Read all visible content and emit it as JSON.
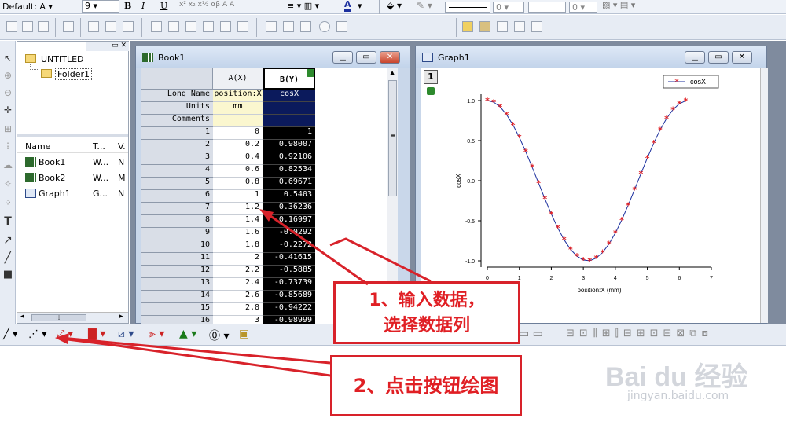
{
  "toolbar": {
    "font_label": "Default: A",
    "font_size": "9",
    "bold": "B",
    "italic": "I",
    "underline": "U",
    "font_color_letter": "A"
  },
  "explorer": {
    "root": "UNTITLED",
    "folder": "Folder1",
    "columns": [
      "Name",
      "T...",
      "V."
    ],
    "items": [
      {
        "name": "Book1",
        "type": "W...",
        "v": "N"
      },
      {
        "name": "Book2",
        "type": "W...",
        "v": "M"
      },
      {
        "name": "Graph1",
        "type": "G...",
        "v": "N"
      }
    ]
  },
  "book": {
    "title": "Book1",
    "col_a": "A(X)",
    "col_b": "B(Y)",
    "labels": [
      "Long Name",
      "Units",
      "Comments"
    ],
    "a_long": "position:X",
    "a_units": "mm",
    "b_long": "cosX",
    "rows": [
      {
        "n": "1",
        "a": "0",
        "b": "1"
      },
      {
        "n": "2",
        "a": "0.2",
        "b": "0.98007"
      },
      {
        "n": "3",
        "a": "0.4",
        "b": "0.92106"
      },
      {
        "n": "4",
        "a": "0.6",
        "b": "0.82534"
      },
      {
        "n": "5",
        "a": "0.8",
        "b": "0.69671"
      },
      {
        "n": "6",
        "a": "1",
        "b": "0.5403"
      },
      {
        "n": "7",
        "a": "1.2",
        "b": "0.36236"
      },
      {
        "n": "8",
        "a": "1.4",
        "b": "0.16997"
      },
      {
        "n": "9",
        "a": "1.6",
        "b": "-0.0292"
      },
      {
        "n": "10",
        "a": "1.8",
        "b": "-0.2272"
      },
      {
        "n": "11",
        "a": "2",
        "b": "-0.41615"
      },
      {
        "n": "12",
        "a": "2.2",
        "b": "-0.5885"
      },
      {
        "n": "13",
        "a": "2.4",
        "b": "-0.73739"
      },
      {
        "n": "14",
        "a": "2.6",
        "b": "-0.85689"
      },
      {
        "n": "15",
        "a": "2.8",
        "b": "-0.94222"
      },
      {
        "n": "16",
        "a": "3",
        "b": "-0.98999"
      }
    ]
  },
  "graph": {
    "title": "Graph1",
    "layer": "1",
    "legend": "cosX",
    "xlabel": "position:X (mm)",
    "ylabel": "cosX",
    "xticks": [
      "0",
      "1",
      "2",
      "3",
      "4",
      "5",
      "6",
      "7"
    ],
    "yticks": [
      "1.0",
      "0.5",
      "0.0",
      "-0.5",
      "-1.0"
    ]
  },
  "chart_data": {
    "type": "line",
    "series": [
      {
        "name": "cosX",
        "x": [
          0,
          0.2,
          0.4,
          0.6,
          0.8,
          1,
          1.2,
          1.4,
          1.6,
          1.8,
          2,
          2.2,
          2.4,
          2.6,
          2.8,
          3,
          3.2,
          3.4,
          3.6,
          3.8,
          4,
          4.2,
          4.4,
          4.6,
          4.8,
          5,
          5.2,
          5.4,
          5.6,
          5.8,
          6,
          6.2
        ],
        "y": [
          1,
          0.98007,
          0.92106,
          0.82534,
          0.69671,
          0.5403,
          0.36236,
          0.16997,
          -0.0292,
          -0.2272,
          -0.41615,
          -0.5885,
          -0.73739,
          -0.85689,
          -0.94222,
          -0.98999,
          -0.99829,
          -0.9668,
          -0.89676,
          -0.79097,
          -0.65364,
          -0.49026,
          -0.30733,
          -0.11215,
          0.0875,
          0.28366,
          0.46852,
          0.63469,
          0.77557,
          0.88552,
          0.96017,
          0.99668
        ]
      }
    ],
    "xlim": [
      0,
      7
    ],
    "ylim": [
      -1.0,
      1.0
    ],
    "xlabel": "position:X (mm)",
    "ylabel": "cosX",
    "grid": false,
    "legend": "top-right",
    "line_color": "#1b2f9e",
    "marker_color": "#e01f24"
  },
  "callouts": {
    "first": "1、输入数据，\n选择数据列",
    "second": "2、点击按钮绘图"
  },
  "watermark": "Bai du 经验",
  "watermark_url": "jingyan.baidu.com",
  "colors": {
    "accent": "#e01f24",
    "selection": "#000000",
    "header": "#d9dee7"
  }
}
